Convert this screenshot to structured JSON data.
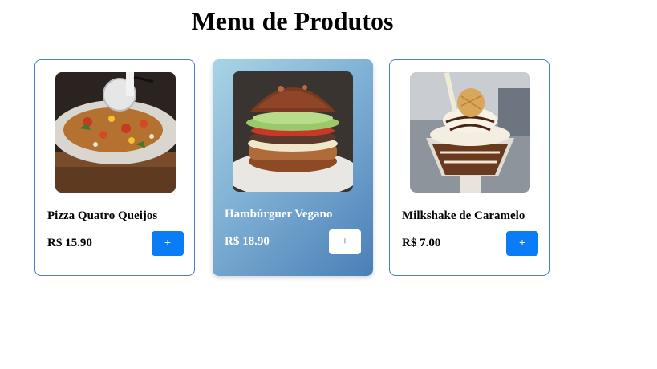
{
  "page": {
    "title": "Menu de Produtos"
  },
  "products": [
    {
      "name": "Pizza Quatro Queijos",
      "price": "R$ 15.90",
      "add_label": "+",
      "image": "pizza-photo"
    },
    {
      "name": "Hambúrguer Vegano",
      "price": "R$ 18.90",
      "add_label": "+",
      "image": "burger-photo"
    },
    {
      "name": "Milkshake de Caramelo",
      "price": "R$ 7.00",
      "add_label": "+",
      "image": "milkshake-photo"
    }
  ],
  "colors": {
    "card_border": "#4a7fc1",
    "button_blue": "#0a7cf5",
    "highlight_gradient_start": "#a9d4e6",
    "highlight_gradient_end": "#4a7fb7"
  }
}
